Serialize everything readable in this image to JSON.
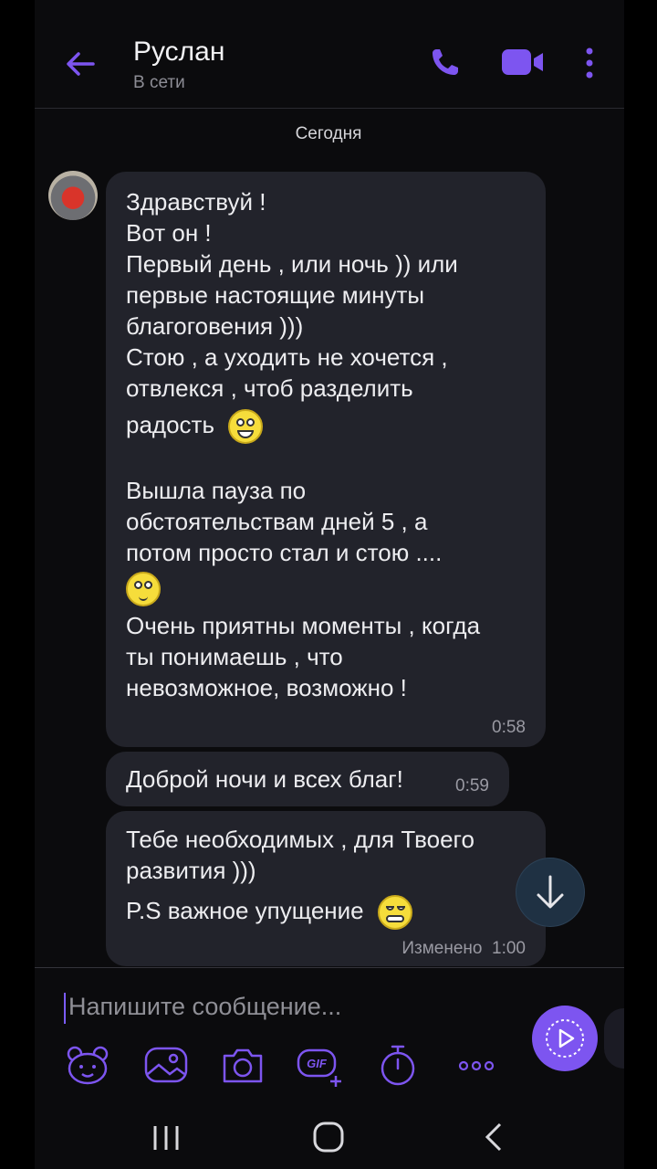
{
  "header": {
    "contact_name": "Руслан",
    "contact_status": "В сети"
  },
  "date_separator": "Сегодня",
  "messages": [
    {
      "lines": [
        "Здравствуй !",
        "Вот он !",
        "Первый день , или ночь )) или",
        "первые настоящие минуты",
        "благоговения )))",
        "Стою , а уходить не хочется ,",
        "отвлекся , чтоб разделить",
        "радость",
        "",
        "Вышла пауза по",
        "обстоятельствам дней 5 , а",
        "потом просто стал и стою ....",
        "",
        "Очень приятны моменты , когда",
        "ты понимаешь , что",
        "невозможное, возможно !"
      ],
      "time": "0:58"
    },
    {
      "text": "Доброй ночи и всех благ!",
      "time": "0:59"
    },
    {
      "lines": [
        "Тебе необходимых , для Твоего",
        "развития )))",
        "P.S важное упущение"
      ],
      "edited_label": "Изменено",
      "time": "1:00"
    }
  ],
  "composer": {
    "placeholder": "Напишите сообщение..."
  },
  "colors": {
    "accent": "#7d55f0",
    "bubble": "#22232b",
    "background": "#0b0b0d"
  }
}
